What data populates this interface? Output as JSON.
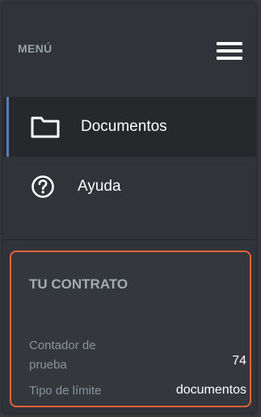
{
  "header": {
    "title": "MENÚ",
    "menu_icon": "hamburger-icon"
  },
  "nav": {
    "items": [
      {
        "label": "Documentos",
        "icon": "folder-icon",
        "active": true
      },
      {
        "label": "Ayuda",
        "icon": "help-circle-icon",
        "active": false
      }
    ]
  },
  "contract": {
    "title": "TU CONTRATO",
    "counter_label": "Contador de prueba",
    "counter_value": "74",
    "limit_label": "Tipo de límite",
    "limit_value": "documentos",
    "border_color": "#e0643a"
  },
  "colors": {
    "background": "#303338",
    "active_item": "#26282c",
    "accent": "#4f7fbd"
  }
}
